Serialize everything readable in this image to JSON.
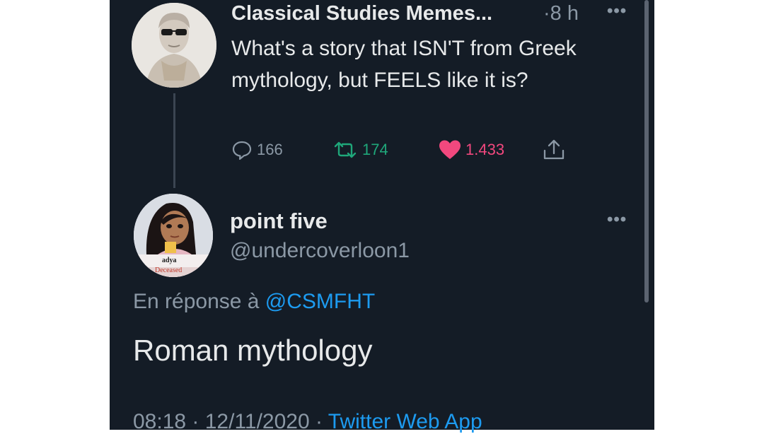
{
  "tweet": {
    "author_name": "Classical Studies Memes...",
    "time": "·8 h",
    "text": "What's a story that ISN'T from Greek mythology, but FEELS like it is?",
    "replies": "166",
    "retweets": "174",
    "likes": "1.433",
    "more_icon": "more-icon"
  },
  "reply": {
    "author_name": "point five",
    "handle": "@undercoverloon1",
    "avatar_caption": "adya",
    "avatar_sub": "Deceased",
    "reply_prefix": "En réponse à ",
    "reply_to_handle": "@CSMFHT",
    "text": "Roman mythology",
    "timestamp": "08:18 · 12/11/2020 · ",
    "source_app": "Twitter Web App"
  },
  "colors": {
    "background": "#141c26",
    "link": "#1d9bf0",
    "retweet": "#1fa77a",
    "like": "#f2487e",
    "muted": "#8b98a5"
  }
}
